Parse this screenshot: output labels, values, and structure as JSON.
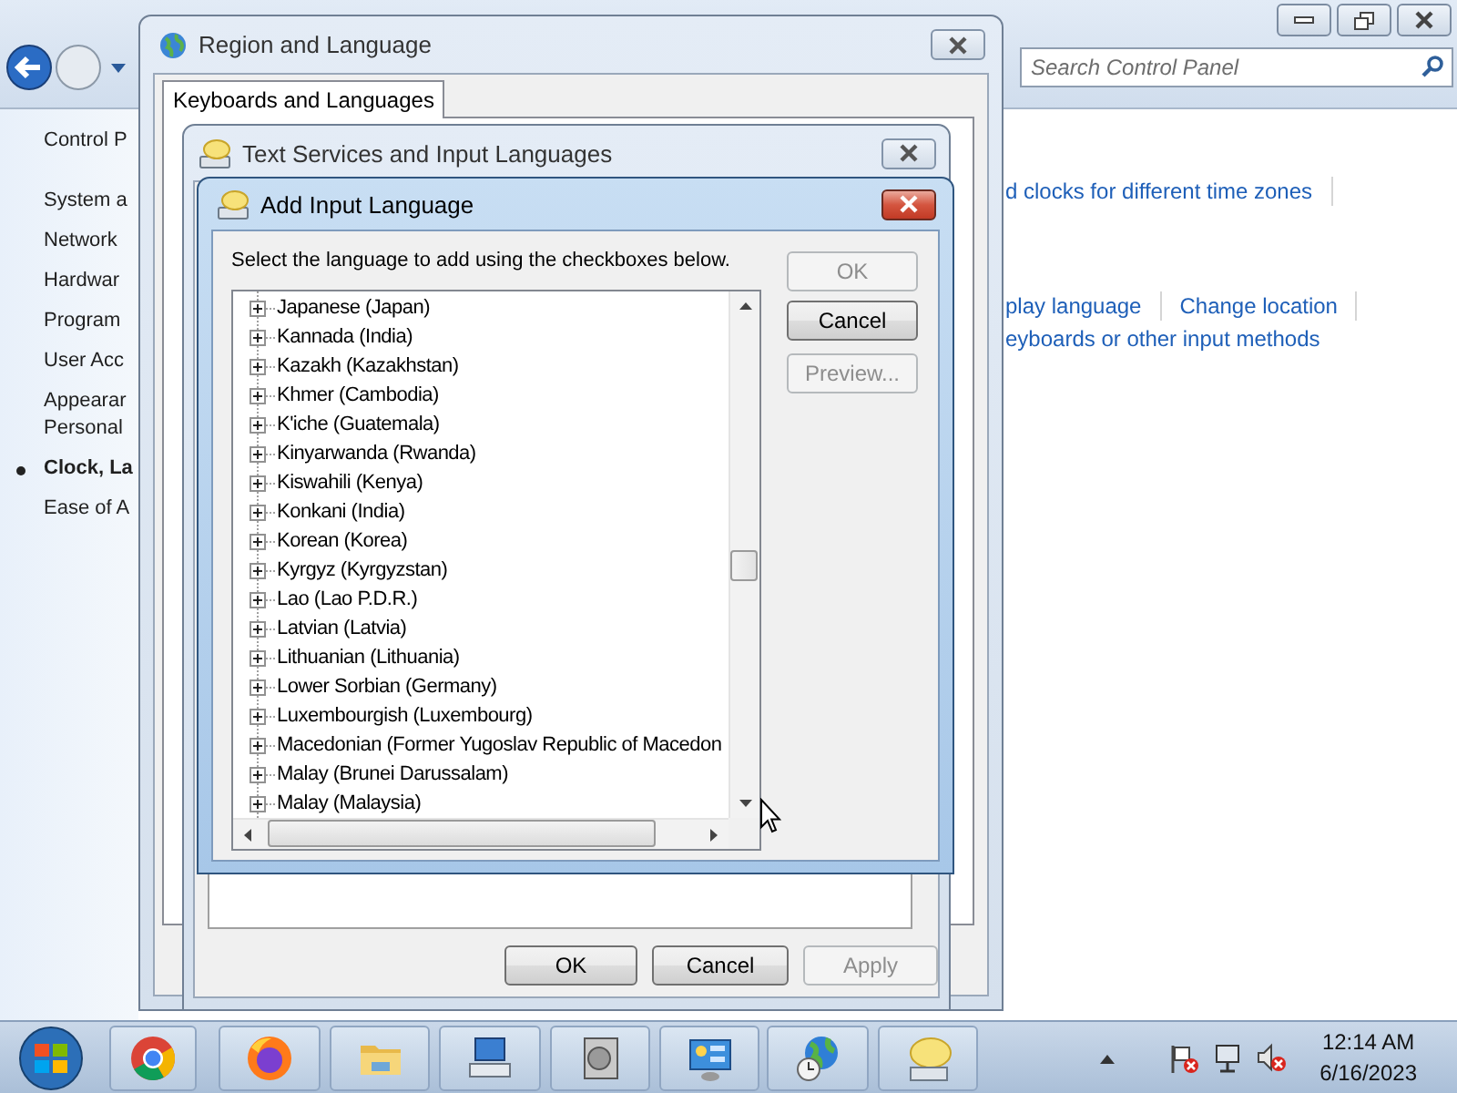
{
  "control_panel": {
    "search": {
      "placeholder": "Search Control Panel"
    },
    "sidebar": {
      "items": [
        {
          "label": "Control P",
          "selected": false
        },
        {
          "label": "System a",
          "selected": false
        },
        {
          "label": "Network",
          "selected": false
        },
        {
          "label": "Hardwar",
          "selected": false
        },
        {
          "label": "Program",
          "selected": false
        },
        {
          "label": "User Acc",
          "selected": false
        },
        {
          "label": "Appearar\nPersonal",
          "selected": false
        },
        {
          "label": "Clock, La",
          "selected": true
        },
        {
          "label": "Ease of A",
          "selected": false
        }
      ]
    },
    "link_rows": [
      [
        "d clocks for different time zones"
      ],
      [
        "play language",
        "Change location"
      ],
      [
        "eyboards or other input methods"
      ]
    ]
  },
  "region_window": {
    "title": "Region and Language",
    "tabs": [
      {
        "label": "Keyboards and Languages",
        "selected": true
      }
    ]
  },
  "text_services_window": {
    "title": "Text Services and Input Languages",
    "buttons": [
      {
        "label": "OK",
        "disabled": false
      },
      {
        "label": "Cancel",
        "disabled": false
      },
      {
        "label": "Apply",
        "disabled": true
      }
    ]
  },
  "add_input_language": {
    "title": "Add Input Language",
    "instruction": "Select the language to add using the checkboxes below.",
    "languages": [
      {
        "label": "Japanese (Japan)",
        "expanded": false
      },
      {
        "label": "Kannada (India)",
        "expanded": false
      },
      {
        "label": "Kazakh (Kazakhstan)",
        "expanded": false
      },
      {
        "label": "Khmer (Cambodia)",
        "expanded": false
      },
      {
        "label": "K'iche (Guatemala)",
        "expanded": false
      },
      {
        "label": "Kinyarwanda (Rwanda)",
        "expanded": false
      },
      {
        "label": "Kiswahili (Kenya)",
        "expanded": false
      },
      {
        "label": "Konkani (India)",
        "expanded": false
      },
      {
        "label": "Korean (Korea)",
        "expanded": false
      },
      {
        "label": "Kyrgyz (Kyrgyzstan)",
        "expanded": false
      },
      {
        "label": "Lao (Lao P.D.R.)",
        "expanded": false
      },
      {
        "label": "Latvian (Latvia)",
        "expanded": false
      },
      {
        "label": "Lithuanian (Lithuania)",
        "expanded": false
      },
      {
        "label": "Lower Sorbian (Germany)",
        "expanded": false
      },
      {
        "label": "Luxembourgish (Luxembourg)",
        "expanded": false
      },
      {
        "label": "Macedonian (Former Yugoslav Republic of Macedon",
        "expanded": false
      },
      {
        "label": "Malay (Brunei Darussalam)",
        "expanded": false
      },
      {
        "label": "Malay (Malaysia)",
        "expanded": false
      }
    ],
    "buttons": [
      {
        "label": "OK",
        "disabled": true
      },
      {
        "label": "Cancel",
        "disabled": false
      },
      {
        "label": "Preview...",
        "disabled": true
      }
    ]
  },
  "taskbar": {
    "time": "12:14 AM",
    "date": "6/16/2023"
  }
}
